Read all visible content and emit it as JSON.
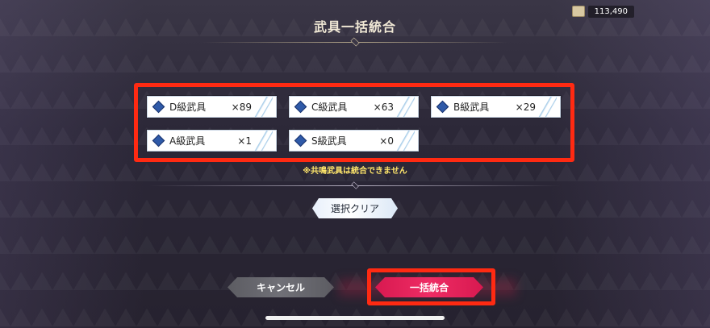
{
  "header": {
    "title": "武具一括統合"
  },
  "currency": {
    "icon": "scroll-icon",
    "value": "113,490"
  },
  "weapons": [
    {
      "name": "D級武具",
      "count": "×89"
    },
    {
      "name": "C級武具",
      "count": "×63"
    },
    {
      "name": "B級武具",
      "count": "×29"
    },
    {
      "name": "A級武具",
      "count": "×1"
    },
    {
      "name": "S級武具",
      "count": "×0"
    }
  ],
  "note": "※共鳴武具は統合できません",
  "actions": {
    "clear_label": "選択クリア",
    "cancel_label": "キャンセル",
    "combine_label": "一括統合"
  },
  "colors": {
    "highlight": "#ff2a12",
    "combine": "#e6245c",
    "note": "#ffe66b"
  }
}
